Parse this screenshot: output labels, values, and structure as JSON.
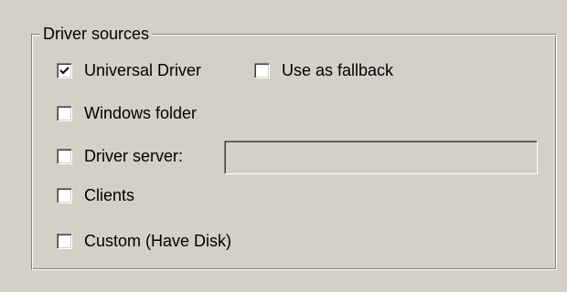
{
  "group": {
    "title": "Driver sources"
  },
  "options": {
    "universal_driver": {
      "label": "Universal Driver",
      "checked": true
    },
    "use_as_fallback": {
      "label": "Use as fallback",
      "checked": false
    },
    "windows_folder": {
      "label": "Windows folder",
      "checked": false
    },
    "driver_server": {
      "label": "Driver server:",
      "checked": false
    },
    "clients": {
      "label": "Clients",
      "checked": false
    },
    "custom": {
      "label": "Custom (Have Disk)",
      "checked": false
    }
  },
  "driver_server_field": {
    "value": ""
  }
}
